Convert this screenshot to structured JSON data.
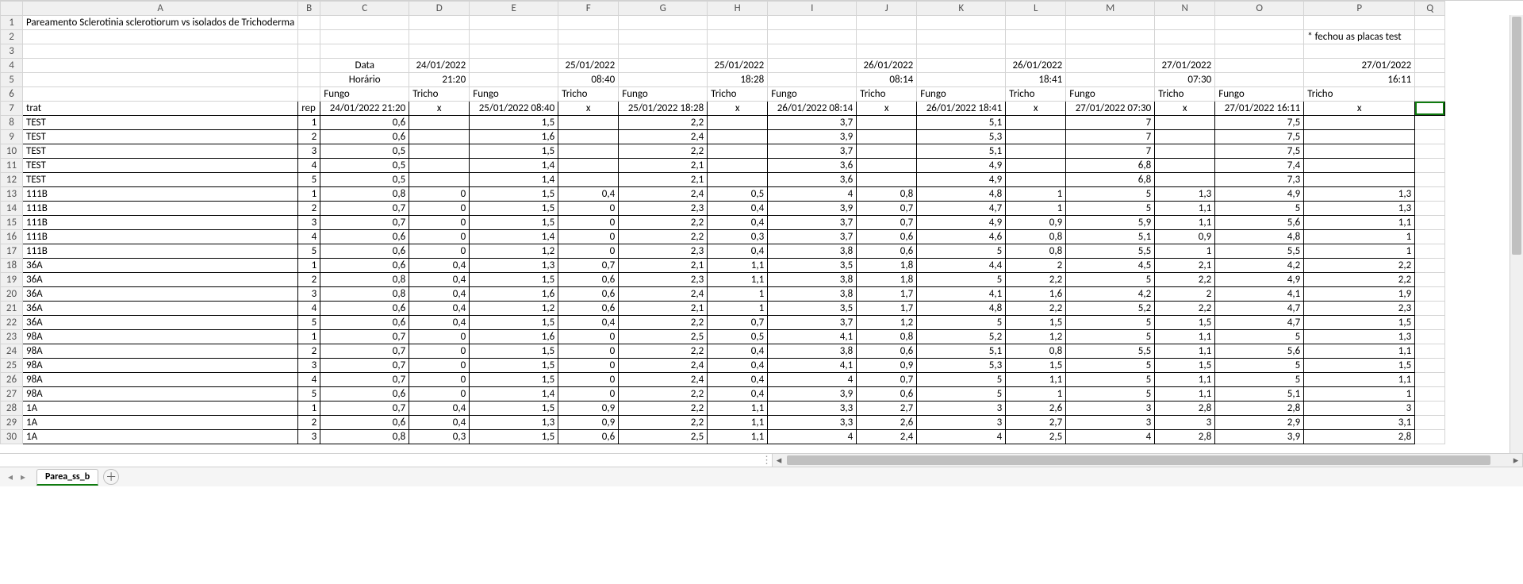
{
  "sheet_tab": "Parea_ss_b",
  "title": "Pareamento Sclerotinia sclerotiorum vs isolados de Trichoderma",
  "note_row2": "* fechou as placas test",
  "labels": {
    "Data": "Data",
    "Horario": "Horário",
    "Fungo": "Fungo",
    "Tricho": "Tricho",
    "trat": "trat",
    "rep": "rep",
    "x": "x"
  },
  "col_letters": [
    "A",
    "B",
    "C",
    "D",
    "E",
    "F",
    "G",
    "H",
    "I",
    "J",
    "K",
    "L",
    "M",
    "N",
    "O",
    "P",
    "Q"
  ],
  "dates_row4": {
    "D": "24/01/2022",
    "F": "25/01/2022",
    "H": "25/01/2022",
    "J": "26/01/2022",
    "L": "26/01/2022",
    "N": "27/01/2022",
    "P": "27/01/2022"
  },
  "times_row5": {
    "D": "21:20",
    "F": "08:40",
    "H": "18:28",
    "J": "08:14",
    "L": "18:41",
    "N": "07:30",
    "P": "16:11"
  },
  "header_row7": {
    "C": "24/01/2022 21:20",
    "E": "25/01/2022 08:40",
    "G": "25/01/2022 18:28",
    "I": "26/01/2022 08:14",
    "K": "26/01/2022 18:41",
    "M": "27/01/2022 07:30",
    "O": "27/01/2022 16:11"
  },
  "rows": [
    {
      "r": 8,
      "trat": "TEST",
      "rep": "1",
      "C": "0,6",
      "D": "",
      "E": "1,5",
      "F": "",
      "G": "2,2",
      "H": "",
      "I": "3,7",
      "J": "",
      "K": "5,1",
      "L": "",
      "M": "7",
      "N": "",
      "O": "7,5",
      "P": ""
    },
    {
      "r": 9,
      "trat": "TEST",
      "rep": "2",
      "C": "0,6",
      "D": "",
      "E": "1,6",
      "F": "",
      "G": "2,4",
      "H": "",
      "I": "3,9",
      "J": "",
      "K": "5,3",
      "L": "",
      "M": "7",
      "N": "",
      "O": "7,5",
      "P": ""
    },
    {
      "r": 10,
      "trat": "TEST",
      "rep": "3",
      "C": "0,5",
      "D": "",
      "E": "1,5",
      "F": "",
      "G": "2,2",
      "H": "",
      "I": "3,7",
      "J": "",
      "K": "5,1",
      "L": "",
      "M": "7",
      "N": "",
      "O": "7,5",
      "P": ""
    },
    {
      "r": 11,
      "trat": "TEST",
      "rep": "4",
      "C": "0,5",
      "D": "",
      "E": "1,4",
      "F": "",
      "G": "2,1",
      "H": "",
      "I": "3,6",
      "J": "",
      "K": "4,9",
      "L": "",
      "M": "6,8",
      "N": "",
      "O": "7,4",
      "P": ""
    },
    {
      "r": 12,
      "trat": "TEST",
      "rep": "5",
      "C": "0,5",
      "D": "",
      "E": "1,4",
      "F": "",
      "G": "2,1",
      "H": "",
      "I": "3,6",
      "J": "",
      "K": "4,9",
      "L": "",
      "M": "6,8",
      "N": "",
      "O": "7,3",
      "P": ""
    },
    {
      "r": 13,
      "trat": "111B",
      "rep": "1",
      "C": "0,8",
      "D": "0",
      "E": "1,5",
      "F": "0,4",
      "G": "2,4",
      "H": "0,5",
      "I": "4",
      "J": "0,8",
      "K": "4,8",
      "L": "1",
      "M": "5",
      "N": "1,3",
      "O": "4,9",
      "P": "1,3"
    },
    {
      "r": 14,
      "trat": "111B",
      "rep": "2",
      "C": "0,7",
      "D": "0",
      "E": "1,5",
      "F": "0",
      "G": "2,3",
      "H": "0,4",
      "I": "3,9",
      "J": "0,7",
      "K": "4,7",
      "L": "1",
      "M": "5",
      "N": "1,1",
      "O": "5",
      "P": "1,3"
    },
    {
      "r": 15,
      "trat": "111B",
      "rep": "3",
      "C": "0,7",
      "D": "0",
      "E": "1,5",
      "F": "0",
      "G": "2,2",
      "H": "0,4",
      "I": "3,7",
      "J": "0,7",
      "K": "4,9",
      "L": "0,9",
      "M": "5,9",
      "N": "1,1",
      "O": "5,6",
      "P": "1,1"
    },
    {
      "r": 16,
      "trat": "111B",
      "rep": "4",
      "C": "0,6",
      "D": "0",
      "E": "1,4",
      "F": "0",
      "G": "2,2",
      "H": "0,3",
      "I": "3,7",
      "J": "0,6",
      "K": "4,6",
      "L": "0,8",
      "M": "5,1",
      "N": "0,9",
      "O": "4,8",
      "P": "1"
    },
    {
      "r": 17,
      "trat": "111B",
      "rep": "5",
      "C": "0,6",
      "D": "0",
      "E": "1,2",
      "F": "0",
      "G": "2,3",
      "H": "0,4",
      "I": "3,8",
      "J": "0,6",
      "K": "5",
      "L": "0,8",
      "M": "5,5",
      "N": "1",
      "O": "5,5",
      "P": "1"
    },
    {
      "r": 18,
      "trat": "36A",
      "rep": "1",
      "C": "0,6",
      "D": "0,4",
      "E": "1,3",
      "F": "0,7",
      "G": "2,1",
      "H": "1,1",
      "I": "3,5",
      "J": "1,8",
      "K": "4,4",
      "L": "2",
      "M": "4,5",
      "N": "2,1",
      "O": "4,2",
      "P": "2,2"
    },
    {
      "r": 19,
      "trat": "36A",
      "rep": "2",
      "C": "0,8",
      "D": "0,4",
      "E": "1,5",
      "F": "0,6",
      "G": "2,3",
      "H": "1,1",
      "I": "3,8",
      "J": "1,8",
      "K": "5",
      "L": "2,2",
      "M": "5",
      "N": "2,2",
      "O": "4,9",
      "P": "2,2"
    },
    {
      "r": 20,
      "trat": "36A",
      "rep": "3",
      "C": "0,8",
      "D": "0,4",
      "E": "1,6",
      "F": "0,6",
      "G": "2,4",
      "H": "1",
      "I": "3,8",
      "J": "1,7",
      "K": "4,1",
      "L": "1,6",
      "M": "4,2",
      "N": "2",
      "O": "4,1",
      "P": "1,9"
    },
    {
      "r": 21,
      "trat": "36A",
      "rep": "4",
      "C": "0,6",
      "D": "0,4",
      "E": "1,2",
      "F": "0,6",
      "G": "2,1",
      "H": "1",
      "I": "3,5",
      "J": "1,7",
      "K": "4,8",
      "L": "2,2",
      "M": "5,2",
      "N": "2,2",
      "O": "4,7",
      "P": "2,3"
    },
    {
      "r": 22,
      "trat": "36A",
      "rep": "5",
      "C": "0,6",
      "D": "0,4",
      "E": "1,5",
      "F": "0,4",
      "G": "2,2",
      "H": "0,7",
      "I": "3,7",
      "J": "1,2",
      "K": "5",
      "L": "1,5",
      "M": "5",
      "N": "1,5",
      "O": "4,7",
      "P": "1,5"
    },
    {
      "r": 23,
      "trat": "98A",
      "rep": "1",
      "C": "0,7",
      "D": "0",
      "E": "1,6",
      "F": "0",
      "G": "2,5",
      "H": "0,5",
      "I": "4,1",
      "J": "0,8",
      "K": "5,2",
      "L": "1,2",
      "M": "5",
      "N": "1,1",
      "O": "5",
      "P": "1,3"
    },
    {
      "r": 24,
      "trat": "98A",
      "rep": "2",
      "C": "0,7",
      "D": "0",
      "E": "1,5",
      "F": "0",
      "G": "2,2",
      "H": "0,4",
      "I": "3,8",
      "J": "0,6",
      "K": "5,1",
      "L": "0,8",
      "M": "5,5",
      "N": "1,1",
      "O": "5,6",
      "P": "1,1"
    },
    {
      "r": 25,
      "trat": "98A",
      "rep": "3",
      "C": "0,7",
      "D": "0",
      "E": "1,5",
      "F": "0",
      "G": "2,4",
      "H": "0,4",
      "I": "4,1",
      "J": "0,9",
      "K": "5,3",
      "L": "1,5",
      "M": "5",
      "N": "1,5",
      "O": "5",
      "P": "1,5"
    },
    {
      "r": 26,
      "trat": "98A",
      "rep": "4",
      "C": "0,7",
      "D": "0",
      "E": "1,5",
      "F": "0",
      "G": "2,4",
      "H": "0,4",
      "I": "4",
      "J": "0,7",
      "K": "5",
      "L": "1,1",
      "M": "5",
      "N": "1,1",
      "O": "5",
      "P": "1,1"
    },
    {
      "r": 27,
      "trat": "98A",
      "rep": "5",
      "C": "0,6",
      "D": "0",
      "E": "1,4",
      "F": "0",
      "G": "2,2",
      "H": "0,4",
      "I": "3,9",
      "J": "0,6",
      "K": "5",
      "L": "1",
      "M": "5",
      "N": "1,1",
      "O": "5,1",
      "P": "1"
    },
    {
      "r": 28,
      "trat": "1A",
      "rep": "1",
      "C": "0,7",
      "D": "0,4",
      "E": "1,5",
      "F": "0,9",
      "G": "2,2",
      "H": "1,1",
      "I": "3,3",
      "J": "2,7",
      "K": "3",
      "L": "2,6",
      "M": "3",
      "N": "2,8",
      "O": "2,8",
      "P": "3"
    },
    {
      "r": 29,
      "trat": "1A",
      "rep": "2",
      "C": "0,6",
      "D": "0,4",
      "E": "1,3",
      "F": "0,9",
      "G": "2,2",
      "H": "1,1",
      "I": "3,3",
      "J": "2,6",
      "K": "3",
      "L": "2,7",
      "M": "3",
      "N": "3",
      "O": "2,9",
      "P": "3,1"
    },
    {
      "r": 30,
      "trat": "1A",
      "rep": "3",
      "C": "0,8",
      "D": "0,3",
      "E": "1,5",
      "F": "0,6",
      "G": "2,5",
      "H": "1,1",
      "I": "4",
      "J": "2,4",
      "K": "4",
      "L": "2,5",
      "M": "4",
      "N": "2,8",
      "O": "3,9",
      "P": "2,8"
    }
  ]
}
